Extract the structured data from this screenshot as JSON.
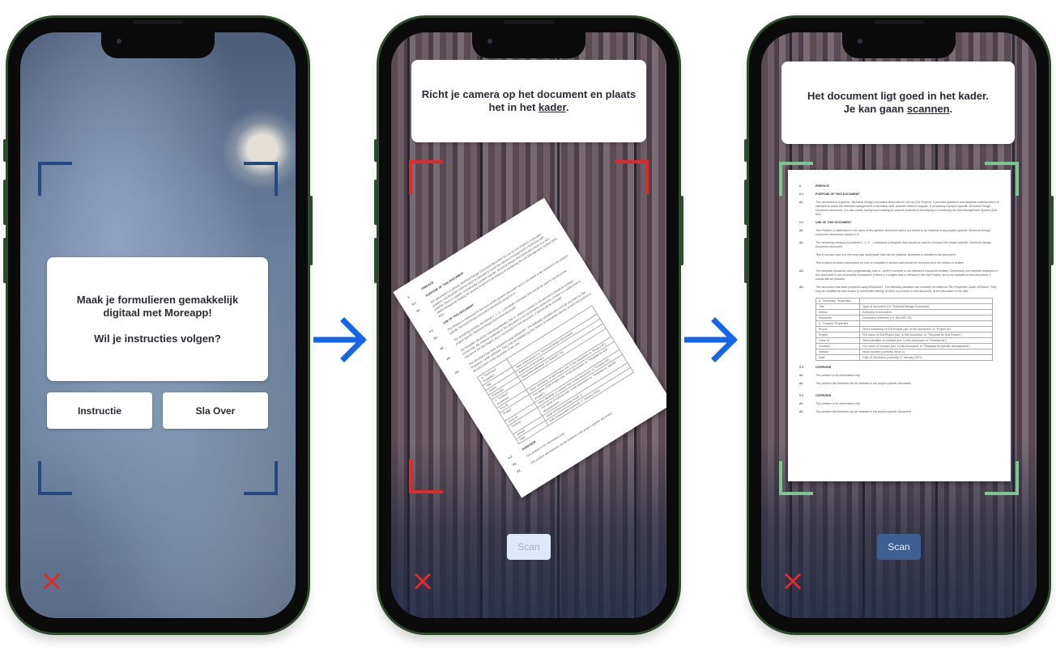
{
  "colors": {
    "frame_neutral": "#23497f",
    "frame_invalid": "#e0292b",
    "frame_valid": "#7ec495",
    "close": "#e0292b",
    "arrow": "#1565e8",
    "scan_disabled_bg": "#dde8fb",
    "scan_active_bg": "#3f5e92"
  },
  "screens": [
    {
      "dialog": {
        "line1": "Maak je formulieren gemakkelijk",
        "line2": "digitaal met Moreapp!",
        "question": "Wil je instructies volgen?"
      },
      "buttons": {
        "instruction": "Instructie",
        "skip": "Sla Over"
      },
      "close_icon": "close-icon"
    },
    {
      "banner": {
        "text_before": "Richt je camera op het document en plaats het in het ",
        "link": "kader",
        "text_after": "."
      },
      "scan_label": "Scan",
      "scan_state": "disabled",
      "close_icon": "close-icon"
    },
    {
      "banner": {
        "line1": "Het document ligt goed in het kader.",
        "text_before": "Je kan gaan ",
        "link": "scannen",
        "text_after": "."
      },
      "scan_label": "Scan",
      "scan_state": "enabled",
      "close_icon": "close-icon"
    }
  ],
  "document": {
    "sections": [
      {
        "num": "0",
        "title": "PREFACE"
      },
      {
        "num": "0.1",
        "title": "PURPOSE OF THIS DOCUMENT"
      },
      {
        "num": "0.2",
        "title": "USE OF THIS DOCUMENT"
      },
      {
        "num": "0.3",
        "title": "OVERVIEW"
      },
      {
        "num": "0.3",
        "title": "OVERVIEW"
      }
    ],
    "para_purpose": "This document is a generic Technical Design Document document for use by IDA Projects. It provides guidance and template material which is intended to assist the relevant management or technical staff, whether client or supplier, in producing a project-specific Technical Design Document document. It is also useful background reading for anyone involved in developing or monitoring the IDA Management System (IDA-MS).",
    "para_use1": "This Preface is addressed to the users of this generic document and is not meant to be retained in any project-specific Technical Design Document documents based on it.",
    "para_use2": "The remaining sections (numbered 1, 2, 3,...) constitute a template that should be used to construct the project-specific Technical Design Document document.",
    "bullet1": "Text in normal case is in the most part 'boilerplate' that can be retained, amended or deleted in the document.",
    "bullet2": "Text in italics provides instructions on how to complete a section and should be removed once the section is written.",
    "para_use3": "The template should be used pragmatically, that is - where a section is not relevant it should be omitted. Conversely, the material contained in this document is not necessarily exhaustive; if there is a subject that is relevant to the IDA Project, but is not included in this document, it should still be included.",
    "para_use4": "This document has been prepared using MSWord97. The following variables are currently recorded as File 'Properties' under MSWord. They may be modified by that means or overwritten directly at each occurrence in the document, at the discretion of the user.",
    "table": [
      [
        "a. \"Summary\" Properties",
        ""
      ],
      [
        "Title",
        "Type of document (i.e. Technical Design Document)"
      ],
      [
        "Author",
        "Author(s) of document"
      ],
      [
        "Keywords",
        "Document reference (i.e. IDA-MS-TD)"
      ],
      [
        "b. \"Custom\" Properties",
        ""
      ],
      [
        "Proj Id",
        "Short mnemonic of IDA Project (set, in this document, to \"Project Id\")"
      ],
      [
        "Project",
        "Full name of IDA Project (set, in this document, to \"Template for IDA Project\")"
      ],
      [
        "Contr Id",
        "Short identifier of contract (set, in this document, to \"Contract Id\")"
      ],
      [
        "Contract",
        "Full name of contract (set, in this document, to \"Template for specific development\")"
      ],
      [
        "Version",
        "Issue number (currently Issue 1)"
      ],
      [
        "Date",
        "Date of document (currently 17 January 2001)"
      ]
    ],
    "overview1": "This preface is for information only.",
    "overview2": "This preface will therefore not be retained in the project-specific document."
  }
}
